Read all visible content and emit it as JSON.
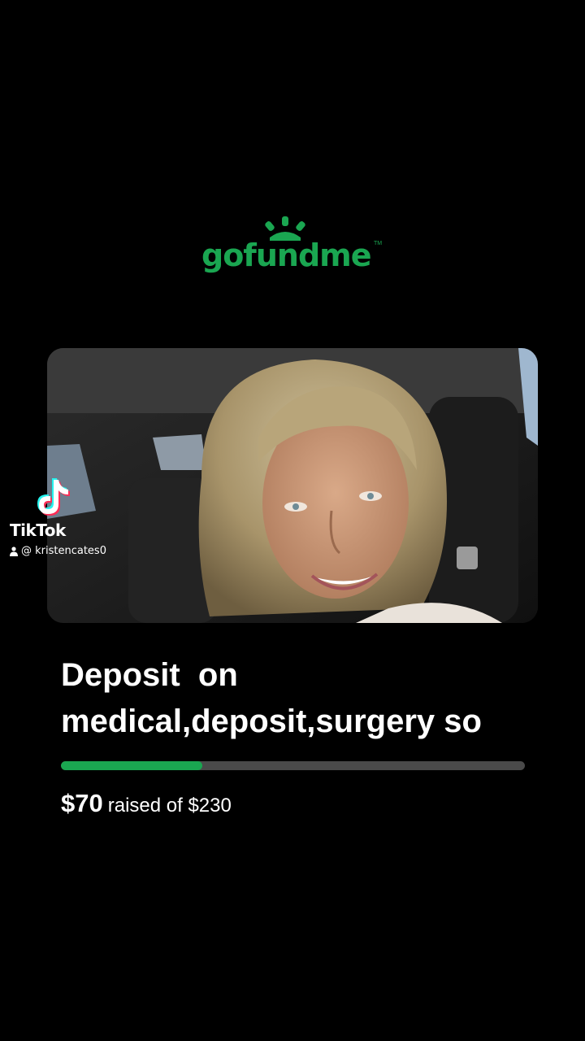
{
  "logo": {
    "wordmark": "gofundme",
    "trademark": "TM",
    "brand_color": "#1aa651"
  },
  "hero": {
    "icon": "campaign-photo"
  },
  "watermark": {
    "brand": "TikTok",
    "username": "@ kristencates0",
    "icon": "tiktok-note-icon",
    "user_icon": "person-icon"
  },
  "campaign": {
    "title_line1": "Deposit  on",
    "title_line2": "medical,deposit,surgery so",
    "raised_amount": "$70",
    "raised_text": "raised of $230",
    "progress_fraction": 0.3043,
    "progress_color": "#1aa651",
    "track_color": "#4a4a4a"
  }
}
